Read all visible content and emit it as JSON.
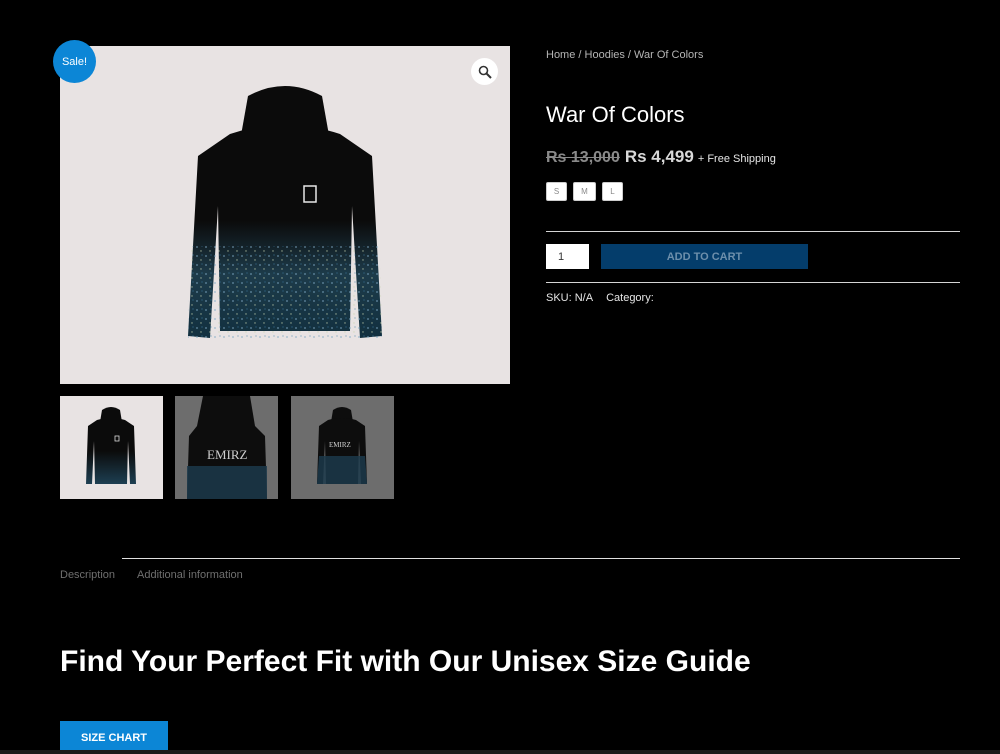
{
  "product": {
    "sale_badge": "Sale!",
    "breadcrumb": [
      "Home",
      "Hoodies",
      "War Of Colors"
    ],
    "breadcrumb_separator": " / ",
    "title": "War Of Colors",
    "price_old": "Rs 13,000",
    "price_new": "Rs 4,499",
    "shipping_note": "+ Free Shipping",
    "sizes": [
      "S",
      "M",
      "L"
    ],
    "quantity": "1",
    "add_to_cart_label": "ADD TO CART",
    "sku": "SKU: N/A",
    "category": "Category:"
  },
  "gallery": {
    "zoom_icon": "magnifier-icon",
    "thumbnail_text": [
      "EMIRZ",
      "EMIRZ"
    ]
  },
  "tabs": [
    "Description",
    "Additional information"
  ],
  "size_guide": {
    "heading": "Find Your Perfect Fit with Our Unisex Size Guide",
    "button_label": "SIZE CHART"
  },
  "colors": {
    "background": "#000000",
    "accent": "#0c86d6",
    "add_to_cart_bg": "#043d6b",
    "image_bg": "#e8e3e3"
  }
}
